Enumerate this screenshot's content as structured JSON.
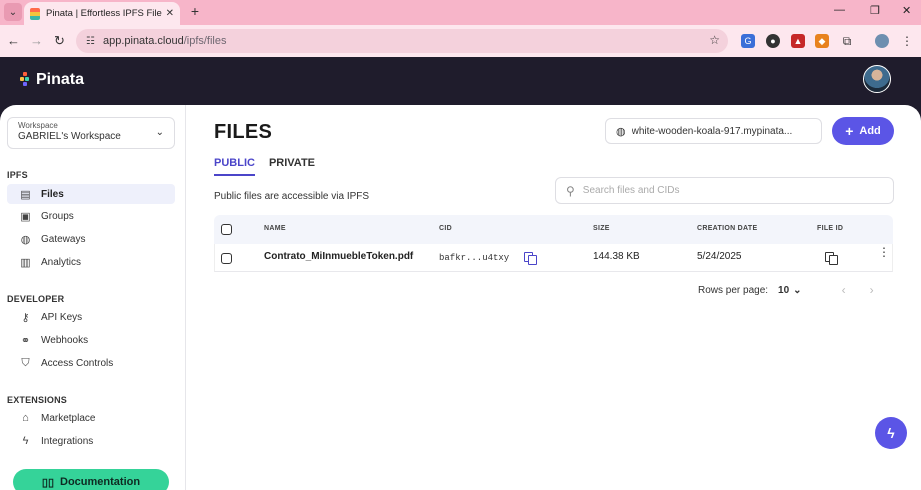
{
  "browser": {
    "tab_title": "Pinata | Effortless IPFS File Mana",
    "url_host": "app.pinata.cloud",
    "url_path": "/ipfs/files"
  },
  "app": {
    "brand": "Pinata"
  },
  "sidebar": {
    "workspace_label": "Workspace",
    "workspace_value": "GABRIEL's Workspace",
    "sections": [
      {
        "title": "IPFS",
        "items": [
          {
            "label": "Files",
            "icon": "file-icon",
            "active": true
          },
          {
            "label": "Groups",
            "icon": "archive-icon"
          },
          {
            "label": "Gateways",
            "icon": "globe-icon"
          },
          {
            "label": "Analytics",
            "icon": "bar-chart-icon"
          }
        ]
      },
      {
        "title": "DEVELOPER",
        "items": [
          {
            "label": "API Keys",
            "icon": "key-icon"
          },
          {
            "label": "Webhooks",
            "icon": "webhook-icon"
          },
          {
            "label": "Access Controls",
            "icon": "shield-icon"
          }
        ]
      },
      {
        "title": "EXTENSIONS",
        "items": [
          {
            "label": "Marketplace",
            "icon": "store-icon"
          },
          {
            "label": "Integrations",
            "icon": "bolt-icon"
          }
        ]
      }
    ],
    "documentation": "Documentation"
  },
  "main": {
    "title": "FILES",
    "gateway": "white-wooden-koala-917.mypinata...",
    "add_label": "Add",
    "tabs": [
      "PUBLIC",
      "PRIVATE"
    ],
    "description": "Public files are accessible via IPFS",
    "search_placeholder": "Search files and CIDs",
    "columns": [
      "NAME",
      "CID",
      "SIZE",
      "CREATION DATE",
      "FILE ID"
    ],
    "rows": [
      {
        "name": "Contrato_MiInmuebleToken.pdf",
        "cid": "bafkr...u4txy",
        "size": "144.38 KB",
        "date": "5/24/2025"
      }
    ],
    "rows_per_page_label": "Rows per page:",
    "rows_per_page_value": "10"
  },
  "colors": {
    "accent": "#5b55e6",
    "doc_button": "#35d399",
    "tabbar": "#f7b5c9"
  }
}
